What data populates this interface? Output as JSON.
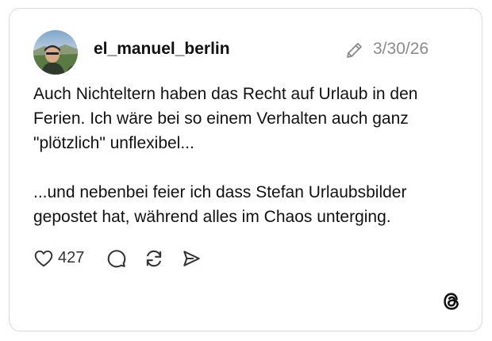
{
  "post": {
    "username": "el_manuel_berlin",
    "date": "3/30/26",
    "paragraphs": [
      "Auch Nichteltern haben das Recht auf Urlaub in den Ferien. Ich wäre bei so einem Verhalten auch ganz \"plötzlich\" unflexibel...",
      "...und nebenbei feier ich dass Stefan Urlaubsbilder gepostet hat, während alles im Chaos unterging."
    ],
    "like_count": "427"
  },
  "icons": {
    "avatar": "avatar-photo",
    "edit": "pencil-icon",
    "like": "heart-icon",
    "comment": "comment-bubble-icon",
    "repost": "repost-icon",
    "share": "send-icon",
    "brand": "threads-logo"
  },
  "colors": {
    "text": "#111111",
    "muted": "#8a8a8a",
    "border": "#d9d9d9",
    "background": "#ffffff"
  }
}
